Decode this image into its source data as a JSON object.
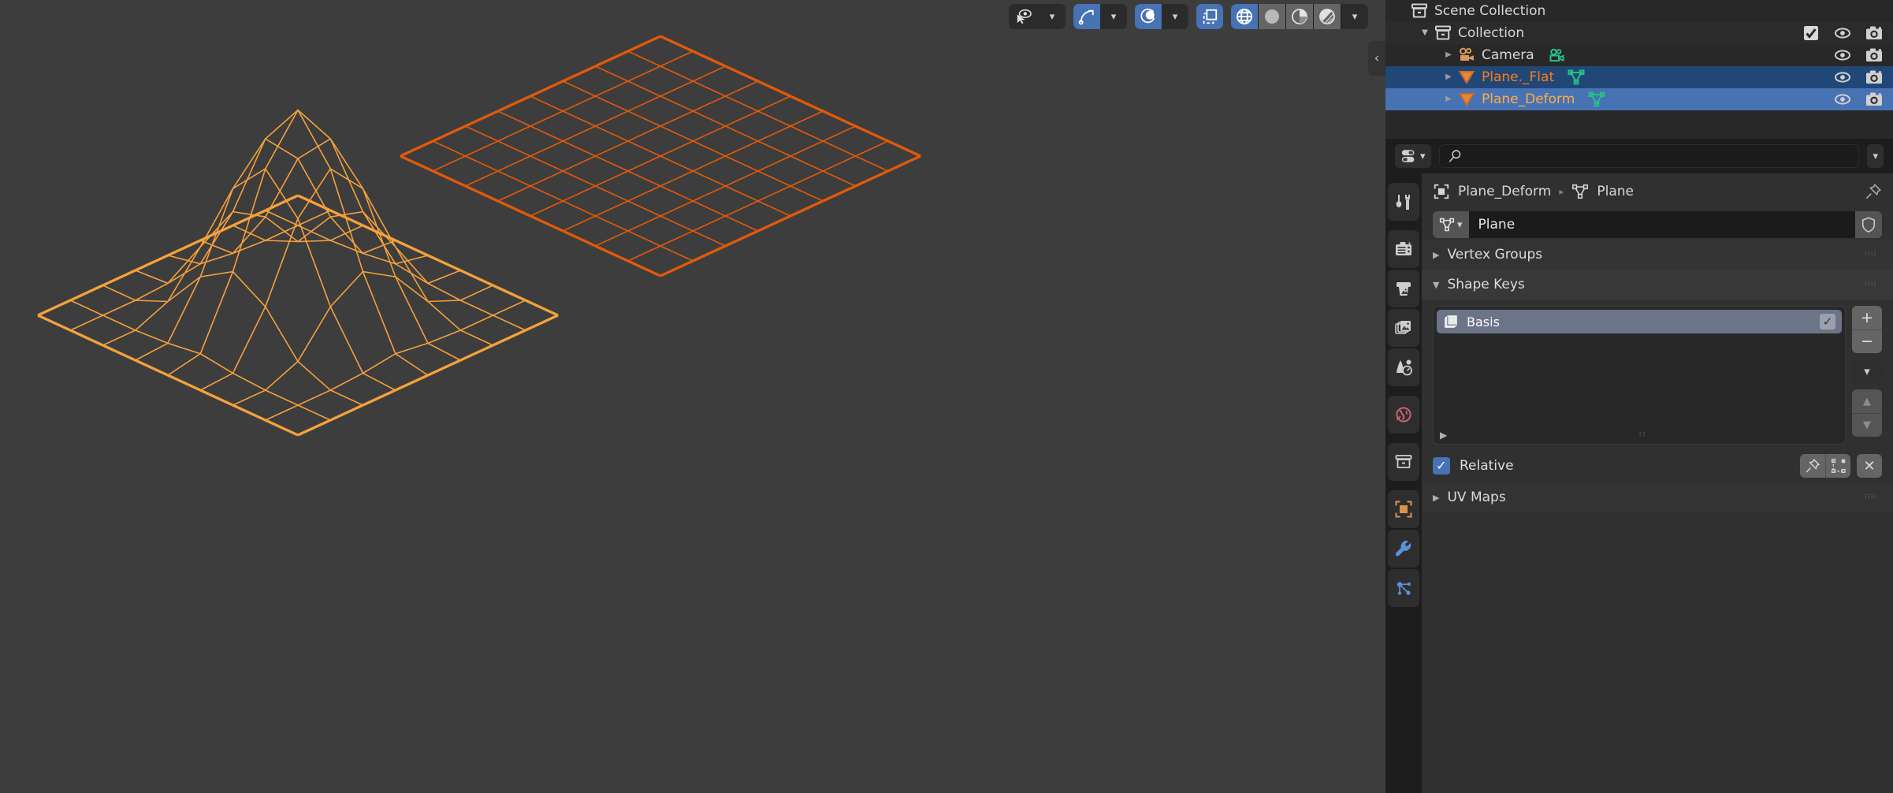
{
  "viewport": {
    "header_buttons": [
      {
        "name": "visibility-selectability-dropdown",
        "icon": "eye-cursor-icon",
        "active": false,
        "has_chevron": true
      },
      {
        "name": "snap-toggle",
        "icon": "magnet-snap-icon",
        "active": true,
        "has_chevron": true
      },
      {
        "name": "proportional-editing-toggle",
        "icon": "proportional-edit-icon",
        "active": true,
        "has_chevron": true
      },
      {
        "name": "toggle-xray",
        "icon": "xray-icon",
        "active": true,
        "has_chevron": false
      },
      {
        "name": "shading-wireframe",
        "icon": "wireframe-globe-icon",
        "active": true,
        "has_chevron": false
      },
      {
        "name": "shading-solid",
        "icon": "solid-sphere-icon",
        "active": false,
        "has_chevron": false
      },
      {
        "name": "shading-material-preview",
        "icon": "material-preview-icon",
        "active": false,
        "has_chevron": false
      },
      {
        "name": "shading-rendered",
        "icon": "rendered-sphere-icon",
        "active": false,
        "has_chevron": false
      },
      {
        "name": "shading-options-dropdown",
        "icon": "chevron-down-icon",
        "active": false,
        "has_chevron": false
      }
    ],
    "sidebar_toggle_icon": "chevron-left-icon",
    "objects": [
      {
        "name": "Plane_Deform",
        "state": "active",
        "color": "#f5a13c"
      },
      {
        "name": "Plane._Flat",
        "state": "selected",
        "color": "#e15a0a"
      }
    ],
    "background_color": "#3d3d3d"
  },
  "outliner": {
    "rows": [
      {
        "label": "Scene Collection",
        "icon": "scene-collection-icon",
        "depth": 0,
        "disclosure": "none",
        "state": "none",
        "toggles": []
      },
      {
        "label": "Collection",
        "icon": "collection-icon",
        "depth": 1,
        "disclosure": "open",
        "state": "none",
        "toggles": [
          "checkbox",
          "eye",
          "camera"
        ]
      },
      {
        "label": "Camera",
        "icon": "camera-object-icon",
        "depth": 2,
        "disclosure": "closed",
        "state": "none",
        "badge": "camera-data-icon",
        "toggles": [
          "eye",
          "camera"
        ]
      },
      {
        "label": "Plane._Flat",
        "icon": "mesh-object-icon",
        "depth": 2,
        "disclosure": "closed",
        "state": "selected",
        "badge": "mesh-data-icon",
        "toggles": [
          "eye",
          "camera"
        ]
      },
      {
        "label": "Plane_Deform",
        "icon": "mesh-object-icon",
        "depth": 2,
        "disclosure": "closed",
        "state": "active",
        "badge": "mesh-data-icon",
        "toggles": [
          "eye",
          "camera"
        ]
      }
    ]
  },
  "properties": {
    "header": {
      "display_filter_icon": "property-filter-icon",
      "search_value": "",
      "search_placeholder": "",
      "search_icon": "search-icon",
      "options_icon": "chevron-down-icon"
    },
    "tabs": [
      {
        "name": "tool",
        "icon": "tool-icon",
        "active": false
      },
      {
        "name": "render",
        "icon": "render-camera-icon",
        "active": false
      },
      {
        "name": "output",
        "icon": "output-printer-icon",
        "active": false
      },
      {
        "name": "view-layer",
        "icon": "view-layer-images-icon",
        "active": false
      },
      {
        "name": "scene",
        "icon": "scene-cone-icon",
        "active": false
      },
      {
        "name": "world",
        "icon": "world-globe-icon",
        "active": false
      },
      {
        "name": "collection",
        "icon": "collection-box-icon",
        "active": false
      },
      {
        "name": "object",
        "icon": "object-square-icon",
        "active": false
      },
      {
        "name": "modifiers",
        "icon": "wrench-icon",
        "active": false
      },
      {
        "name": "particles",
        "icon": "particles-nodes-icon",
        "active": false
      }
    ],
    "breadcrumb": {
      "object_icon": "object-square-icon",
      "object": "Plane_Deform",
      "separator_icon": "chevron-right-icon",
      "data_icon": "mesh-data-icon",
      "data": "Plane",
      "pin_icon": "pin-icon"
    },
    "id_block": {
      "browse_icon": "mesh-data-icon",
      "browse_chevron": "chevron-down-icon",
      "name": "Plane",
      "shield_icon": "fake-user-shield-icon"
    },
    "panels": [
      {
        "name": "vertex-groups",
        "label": "Vertex Groups",
        "open": false,
        "grip_icon": "drag-grip-icon"
      },
      {
        "name": "shape-keys",
        "label": "Shape Keys",
        "open": true,
        "grip_icon": "drag-grip-icon"
      },
      {
        "name": "uv-maps",
        "label": "UV Maps",
        "open": false,
        "grip_icon": "drag-grip-icon"
      }
    ],
    "shape_keys": {
      "items": [
        {
          "name": "Basis",
          "icon": "shapekey-icon",
          "enabled": true,
          "selected": true
        }
      ],
      "side_buttons": [
        {
          "name": "add-shape-key-button",
          "glyph": "+"
        },
        {
          "name": "remove-shape-key-button",
          "glyph": "−"
        },
        {
          "name": "shape-key-specials-menu",
          "glyph": "chevron-down-icon"
        },
        {
          "name": "move-shape-key-up-button",
          "glyph": "triangle-up-icon"
        },
        {
          "name": "move-shape-key-down-button",
          "glyph": "triangle-down-icon"
        }
      ],
      "list_expand_icon": "triangle-right-icon",
      "list_resize_icon": "resize-dots-icon",
      "relative": {
        "label": "Relative",
        "checked": true,
        "pin_icon": "pin-icon",
        "edit_mode_icon": "shape-key-edit-mode-icon",
        "clear_icon": "x-icon"
      }
    }
  },
  "colors": {
    "accent_blue": "#4772b3",
    "select_orange": "#e15a0a",
    "active_orange": "#f5a13c",
    "mesh_teal": "#25c088",
    "viewport_bg": "#3d3d3d",
    "panel_bg": "#303030",
    "editor_bg": "#1d1d1d"
  }
}
